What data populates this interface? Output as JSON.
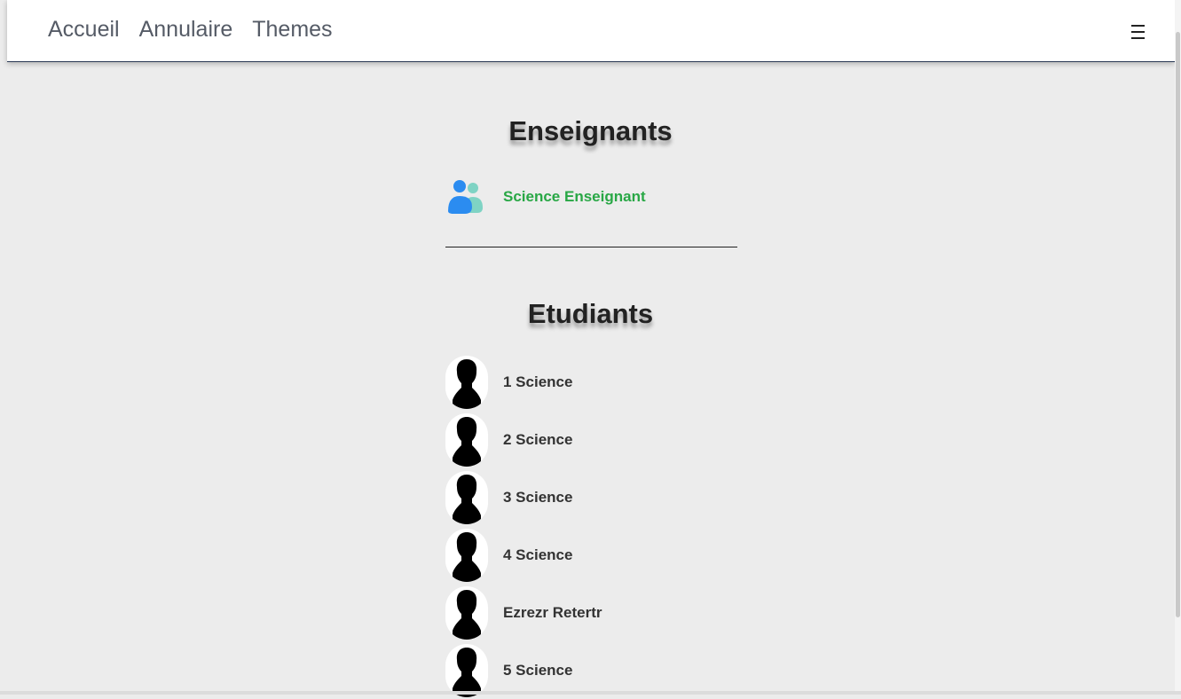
{
  "nav": {
    "links": [
      "Accueil",
      "Annulaire",
      "Themes"
    ],
    "menu_icon": "hamburger-icon"
  },
  "teachers": {
    "title": "Enseignants",
    "items": [
      {
        "name": "Science Enseignant",
        "icon": "users-group-icon",
        "color": "#28a745"
      }
    ]
  },
  "students": {
    "title": "Etudiants",
    "avatar_icon": "person-silhouette-icon",
    "items": [
      {
        "name": "1 Science"
      },
      {
        "name": "2 Science"
      },
      {
        "name": "3 Science"
      },
      {
        "name": "4 Science"
      },
      {
        "name": "Ezrezr Retertr"
      },
      {
        "name": "5 Science"
      }
    ]
  }
}
